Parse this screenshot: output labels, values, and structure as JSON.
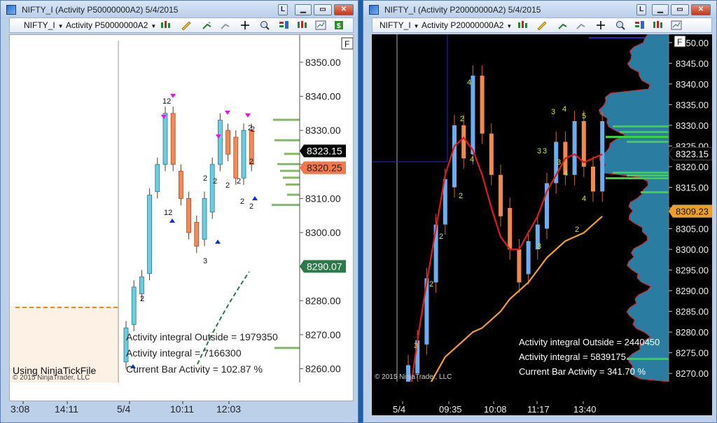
{
  "windows": [
    {
      "title": "NIFTY_I (Activity P50000000A2)  5/4/2015",
      "instrument": "NIFTY_I",
      "period": "Activity P50000000A2",
      "f_button": "F",
      "y_ticks": [
        "8350.00",
        "8340.00",
        "8330.00",
        "8320.00",
        "8310.00",
        "8300.00",
        "8290.00",
        "8280.00",
        "8270.00",
        "8260.00"
      ],
      "x_ticks": [
        "3:08",
        "14:11",
        "5/4",
        "10:11",
        "12:03"
      ],
      "price_markers": {
        "last": "8323.15",
        "orange": "8320.25",
        "green": "8290.07"
      },
      "stats": {
        "outside": "Activity integral Outside  = 1979350",
        "integral": "Activity integral = 7166300",
        "current": "Current Bar Activity = 102.87 %"
      },
      "footer_caption": "Using NinjaTickFile",
      "copyright": "© 2015 NinjaTrader, LLC",
      "bar_labels": [
        "12",
        "2",
        "2",
        "2",
        "2",
        "2",
        "2",
        "2",
        "2",
        "2",
        "3",
        "12",
        "2"
      ]
    },
    {
      "title": "NIFTY_I (Activity P20000000A2)  5/4/2015",
      "instrument": "NIFTY_I",
      "period": "Activity P20000000A2",
      "f_button": "F",
      "y_ticks": [
        "8350.00",
        "8345.00",
        "8340.00",
        "8335.00",
        "8330.00",
        "8325.00",
        "8320.00",
        "8315.00",
        "8310.00",
        "8305.00",
        "8300.00",
        "8295.00",
        "8290.00",
        "8285.00",
        "8280.00",
        "8275.00",
        "8270.00"
      ],
      "x_ticks": [
        "5/4",
        "09:35",
        "10:08",
        "11:17",
        "13:40"
      ],
      "price_markers": {
        "last": "8323.15",
        "orange": "8309.23"
      },
      "stats": {
        "outside": "Activity integral Outside  = 2440450",
        "integral": "Activity integral = 5839175",
        "current": "Current Bar Activity = 341.70 %"
      },
      "copyright": "© 2015 NinjaTrader, LLC",
      "bar_labels": [
        "3",
        "2",
        "2",
        "2",
        "4",
        "2",
        "4",
        "3",
        "3",
        "3",
        "3",
        "4",
        "5",
        "4",
        "4",
        "3",
        "2"
      ]
    }
  ],
  "chart_data": [
    {
      "type": "candlestick",
      "title": "",
      "ylim": [
        8256,
        8358
      ],
      "bars": [
        {
          "o": 8262,
          "c": 8272
        },
        {
          "o": 8273,
          "c": 8284
        },
        {
          "o": 8282,
          "c": 8287
        },
        {
          "o": 8288,
          "c": 8311
        },
        {
          "o": 8312,
          "c": 8320
        },
        {
          "o": 8320,
          "c": 8335
        },
        {
          "o": 8335,
          "c": 8320
        },
        {
          "o": 8318,
          "c": 8310
        },
        {
          "o": 8310,
          "c": 8300
        },
        {
          "o": 8303,
          "c": 8296
        },
        {
          "o": 8298,
          "c": 8310
        },
        {
          "o": 8306,
          "c": 8320
        },
        {
          "o": 8320,
          "c": 8333
        },
        {
          "o": 8330,
          "c": 8323
        },
        {
          "o": 8328,
          "c": 8316
        },
        {
          "o": 8316,
          "c": 8330
        },
        {
          "o": 8330,
          "c": 8320
        }
      ],
      "volume_profile": [
        8333,
        8327,
        8323,
        8320,
        8318,
        8316,
        8314,
        8311,
        8308,
        8266
      ],
      "levels": {
        "last": 8323.15,
        "orange": 8320.25,
        "green": 8290.07,
        "dashed": 8278
      }
    },
    {
      "type": "candlestick",
      "title": "",
      "ylim": [
        8268,
        8352
      ],
      "bars": [
        {
          "o": 8268,
          "c": 8272
        },
        {
          "o": 8270,
          "c": 8278
        },
        {
          "o": 8277,
          "c": 8293
        },
        {
          "o": 8292,
          "c": 8306
        },
        {
          "o": 8306,
          "c": 8317
        },
        {
          "o": 8315,
          "c": 8330
        },
        {
          "o": 8330,
          "c": 8322
        },
        {
          "o": 8323,
          "c": 8342
        },
        {
          "o": 8342,
          "c": 8328
        },
        {
          "o": 8328,
          "c": 8318
        },
        {
          "o": 8318,
          "c": 8308
        },
        {
          "o": 8310,
          "c": 8300
        },
        {
          "o": 8300,
          "c": 8292
        },
        {
          "o": 8294,
          "c": 8302
        },
        {
          "o": 8300,
          "c": 8306
        },
        {
          "o": 8305,
          "c": 8316
        },
        {
          "o": 8316,
          "c": 8326
        },
        {
          "o": 8326,
          "c": 8318
        },
        {
          "o": 8318,
          "c": 8331
        },
        {
          "o": 8331,
          "c": 8320
        },
        {
          "o": 8320,
          "c": 8314
        },
        {
          "o": 8314,
          "c": 8331
        }
      ],
      "ma_red": [
        8262,
        8278,
        8292,
        8305,
        8318,
        8325,
        8327,
        8324,
        8318,
        8310,
        8303,
        8300,
        8300,
        8304,
        8308,
        8314,
        8318,
        8322,
        8323,
        8321,
        8322,
        8323
      ],
      "ma_orange": [
        8260,
        8262,
        8266,
        8270,
        8274,
        8276,
        8278,
        8280,
        8281,
        8283,
        8285,
        8288,
        8290,
        8292,
        8295,
        8298,
        8300,
        8302,
        8303,
        8304,
        8306,
        8308
      ],
      "levels": {
        "last": 8323.15,
        "orange": 8309.23
      }
    }
  ]
}
